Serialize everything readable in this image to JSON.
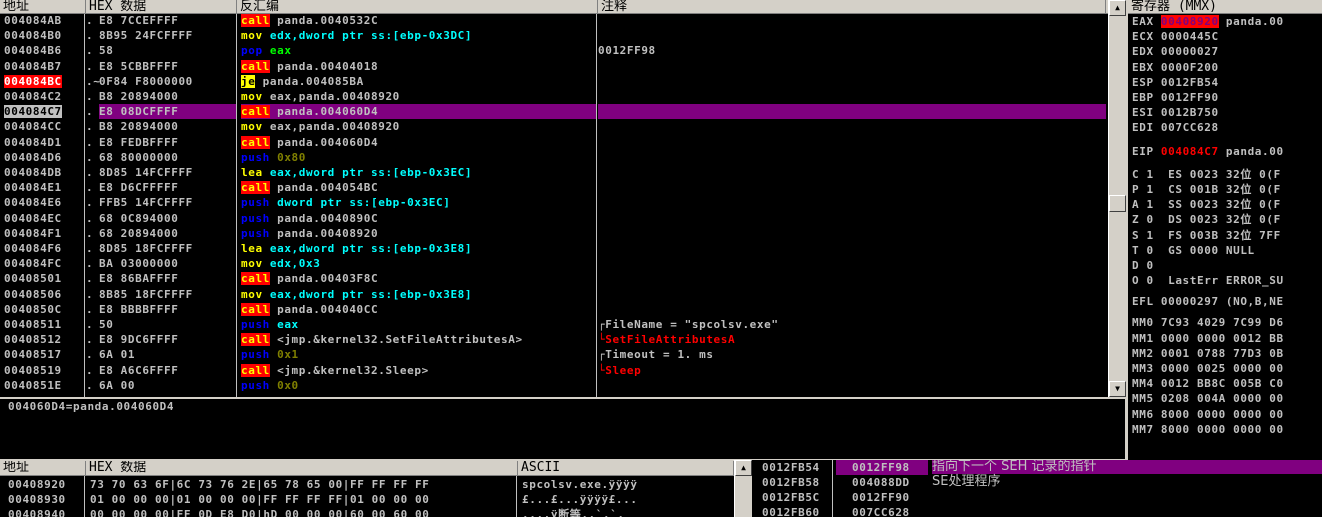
{
  "disasm_headers": {
    "addr": "地址",
    "hex": "HEX 数据",
    "asm": "反汇编",
    "comment": "注释"
  },
  "disasm_rows": [
    {
      "addr": "004084AB",
      "mark": ".",
      "hex": "E8 7CCEFFFF",
      "mn": "call",
      "op": " panda.0040532C",
      "cmt": "",
      "mnc": "m-call",
      "opc": "o-w"
    },
    {
      "addr": "004084B0",
      "mark": ".",
      "hex": "8B95 24FCFFFF",
      "mn": "mov",
      "op": " edx,dword ptr ss:[ebp-0x3DC]",
      "cmt": "",
      "mnc": "m-mov",
      "opc": "o-c"
    },
    {
      "addr": "004084B6",
      "mark": ".",
      "hex": "58",
      "mn": "pop",
      "op": " eax",
      "cmt": "0012FF98",
      "mnc": "m-pop",
      "opc": "o-g"
    },
    {
      "addr": "004084B7",
      "mark": ".",
      "hex": "E8 5CBBFFFF",
      "mn": "call",
      "op": " panda.00404018",
      "cmt": "",
      "mnc": "m-call",
      "opc": "o-w"
    },
    {
      "addr": "004084BC",
      "mark": ".~",
      "hex": "0F84 F8000000",
      "mn": "je",
      "op": " panda.004085BA",
      "cmt": "",
      "mnc": "m-jmp",
      "opc": "o-w",
      "addrc": "addr-bp"
    },
    {
      "addr": "004084C2",
      "mark": ".",
      "hex": "B8 20894000",
      "mn": "mov",
      "op": " eax,panda.00408920",
      "cmt": "",
      "mnc": "m-mov",
      "opc": "o-w"
    },
    {
      "addr": "004084C7",
      "mark": ".",
      "hex": "E8 08DCFFFF",
      "mn": "call",
      "op": " panda.004060D4",
      "cmt": "",
      "mnc": "m-call",
      "opc": "o-w",
      "addrc": "addr-cur",
      "sel": true
    },
    {
      "addr": "004084CC",
      "mark": ".",
      "hex": "B8 20894000",
      "mn": "mov",
      "op": " eax,panda.00408920",
      "cmt": "",
      "mnc": "m-mov",
      "opc": "o-w"
    },
    {
      "addr": "004084D1",
      "mark": ".",
      "hex": "E8 FEDBFFFF",
      "mn": "call",
      "op": " panda.004060D4",
      "cmt": "",
      "mnc": "m-call",
      "opc": "o-w"
    },
    {
      "addr": "004084D6",
      "mark": ".",
      "hex": "68 80000000",
      "mn": "push",
      "op": " 0x80",
      "cmt": "",
      "mnc": "m-push",
      "opc": "o-push"
    },
    {
      "addr": "004084DB",
      "mark": ".",
      "hex": "8D85 14FCFFFF",
      "mn": "lea",
      "op": " eax,dword ptr ss:[ebp-0x3EC]",
      "cmt": "",
      "mnc": "m-lea",
      "opc": "o-c"
    },
    {
      "addr": "004084E1",
      "mark": ".",
      "hex": "E8 D6CFFFFF",
      "mn": "call",
      "op": " panda.004054BC",
      "cmt": "",
      "mnc": "m-call",
      "opc": "o-w"
    },
    {
      "addr": "004084E6",
      "mark": ".",
      "hex": "FFB5 14FCFFFF",
      "mn": "push",
      "op": " dword ptr ss:[ebp-0x3EC]",
      "cmt": "",
      "mnc": "m-push",
      "opc": "o-c"
    },
    {
      "addr": "004084EC",
      "mark": ".",
      "hex": "68 0C894000",
      "mn": "push",
      "op": " panda.0040890C",
      "cmt": "",
      "mnc": "m-push",
      "opc": "o-w"
    },
    {
      "addr": "004084F1",
      "mark": ".",
      "hex": "68 20894000",
      "mn": "push",
      "op": " panda.00408920",
      "cmt": "",
      "mnc": "m-push",
      "opc": "o-w"
    },
    {
      "addr": "004084F6",
      "mark": ".",
      "hex": "8D85 18FCFFFF",
      "mn": "lea",
      "op": " eax,dword ptr ss:[ebp-0x3E8]",
      "cmt": "",
      "mnc": "m-lea",
      "opc": "o-c"
    },
    {
      "addr": "004084FC",
      "mark": ".",
      "hex": "BA 03000000",
      "mn": "mov",
      "op": " edx,0x3",
      "cmt": "",
      "mnc": "m-mov",
      "opc": "o-c"
    },
    {
      "addr": "00408501",
      "mark": ".",
      "hex": "E8 86BAFFFF",
      "mn": "call",
      "op": " panda.00403F8C",
      "cmt": "",
      "mnc": "m-call",
      "opc": "o-w"
    },
    {
      "addr": "00408506",
      "mark": ".",
      "hex": "8B85 18FCFFFF",
      "mn": "mov",
      "op": " eax,dword ptr ss:[ebp-0x3E8]",
      "cmt": "",
      "mnc": "m-mov",
      "opc": "o-c"
    },
    {
      "addr": "0040850C",
      "mark": ".",
      "hex": "E8 BBBBFFFF",
      "mn": "call",
      "op": " panda.004040CC",
      "cmt": "",
      "mnc": "m-call",
      "opc": "o-w"
    },
    {
      "addr": "00408511",
      "mark": ".",
      "hex": "50",
      "mn": "push",
      "op": " eax",
      "cmt": "┌FileName = \"spcolsv.exe\"",
      "mnc": "m-push",
      "opc": "o-c"
    },
    {
      "addr": "00408512",
      "mark": ".",
      "hex": "E8 9DC6FFFF",
      "mn": "call",
      "op": " <jmp.&kernel32.SetFileAttributesA>",
      "cmt": "└SetFileAttributesA",
      "mnc": "m-call",
      "opc": "o-w",
      "cmtc": "cmt-red"
    },
    {
      "addr": "00408517",
      "mark": ".",
      "hex": "6A 01",
      "mn": "push",
      "op": " 0x1",
      "cmt": "┌Timeout = 1. ms",
      "mnc": "m-push",
      "opc": "o-push"
    },
    {
      "addr": "00408519",
      "mark": ".",
      "hex": "E8 A6C6FFFF",
      "mn": "call",
      "op": " <jmp.&kernel32.Sleep>",
      "cmt": "└Sleep",
      "mnc": "m-call",
      "opc": "o-w",
      "cmtc": "cmt-red"
    },
    {
      "addr": "0040851E",
      "mark": ".",
      "hex": "6A 00",
      "mn": "push",
      "op": " 0x0",
      "cmt": "",
      "mnc": "m-push",
      "opc": "o-push"
    }
  ],
  "info_text": "004060D4=panda.004060D4",
  "registers_header": "寄存器 (MMX)",
  "registers": [
    {
      "name": "EAX",
      "val": "00408920",
      "rest": " panda.00",
      "hl": true
    },
    {
      "name": "ECX",
      "val": "0000445C",
      "rest": ""
    },
    {
      "name": "EDX",
      "val": "00000027",
      "rest": ""
    },
    {
      "name": "EBX",
      "val": "0000F200",
      "rest": ""
    },
    {
      "name": "ESP",
      "val": "0012FB54",
      "rest": ""
    },
    {
      "name": "EBP",
      "val": "0012FF90",
      "rest": ""
    },
    {
      "name": "ESI",
      "val": "0012B750",
      "rest": ""
    },
    {
      "name": "EDI",
      "val": "007CC628",
      "rest": ""
    },
    {
      "name": "EIP",
      "val": "004084C7",
      "rest": " panda.00",
      "red": true
    }
  ],
  "flags": [
    "C 1  ES 0023 32位 0(F",
    "P 1  CS 001B 32位 0(F",
    "A 1  SS 0023 32位 0(F",
    "Z 0  DS 0023 32位 0(F",
    "S 1  FS 003B 32位 7FF",
    "T 0  GS 0000 NULL",
    "D 0",
    "O 0  LastErr ERROR_SU"
  ],
  "efl": "EFL 00000297 (NO,B,NE",
  "mmx": [
    "MM0 7C93 4029 7C99 D6",
    "MM1 0000 0000 0012 BB",
    "MM2 0001 0788 77D3 0B",
    "MM3 0000 0025 0000 00",
    "MM4 0012 BB8C 005B C0",
    "MM5 0208 004A 0000 00",
    "MM6 8000 0000 0000 00",
    "MM7 8000 0000 0000 00"
  ],
  "dump_headers": {
    "addr": "地址",
    "hex": "HEX 数据",
    "ascii": "ASCII"
  },
  "dump_rows": [
    {
      "addr": "00408920",
      "hex": "73 70 63 6F|6C 73 76 2E|65 78 65 00|FF FF FF FF",
      "ascii": "spcolsv.exe.ÿÿÿÿ"
    },
    {
      "addr": "00408930",
      "hex": "01 00 00 00|01 00 00 00|FF FF FF FF|01 00 00 00",
      "ascii": "£...£...ÿÿÿÿ£..."
    },
    {
      "addr": "00408940",
      "hex": "00 00 00 00|FF 0D E8 D0|hD 00 00 00|60 00 60 00",
      "ascii": "....ÿ断等..`.`."
    }
  ],
  "stack_rows": [
    {
      "addr": "0012FB54",
      "val": "0012FF98",
      "cmt": "指向下一个 SEH 记录的指针",
      "sel": true
    },
    {
      "addr": "0012FB58",
      "val": "004088DD",
      "cmt": "SE处理程序"
    },
    {
      "addr": "0012FB5C",
      "val": "0012FF90",
      "cmt": ""
    },
    {
      "addr": "0012FB60",
      "val": "007CC628",
      "cmt": ""
    }
  ]
}
